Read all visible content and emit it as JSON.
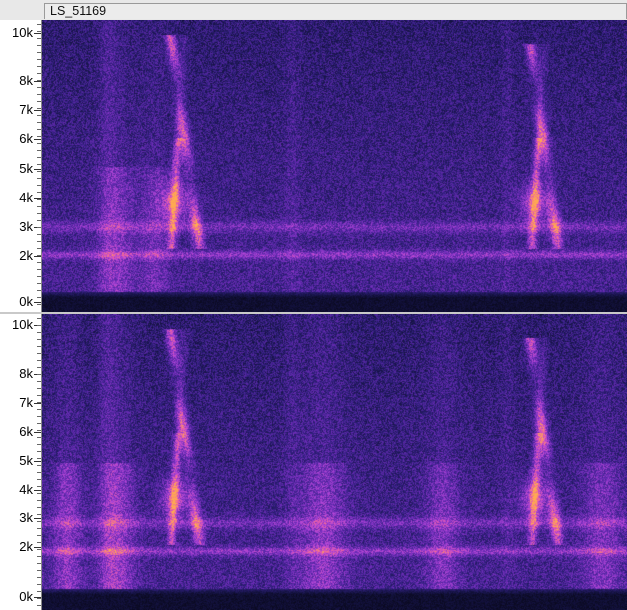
{
  "track": {
    "name": "LS_51169"
  },
  "colors": {
    "background": "#1a1440",
    "noise": "#4a2a9a",
    "band": "#b64fd8",
    "hot": "#ff8a4a",
    "floor": "#050510"
  },
  "channels": [
    {
      "id": "top",
      "ticks": [
        "10k",
        "8k",
        "7k",
        "6k",
        "5k",
        "4k",
        "3k",
        "2k",
        "0k"
      ]
    },
    {
      "id": "bottom",
      "ticks": [
        "10k",
        "8k",
        "7k",
        "6k",
        "5k",
        "4k",
        "3k",
        "2k",
        "0k"
      ]
    }
  ]
}
